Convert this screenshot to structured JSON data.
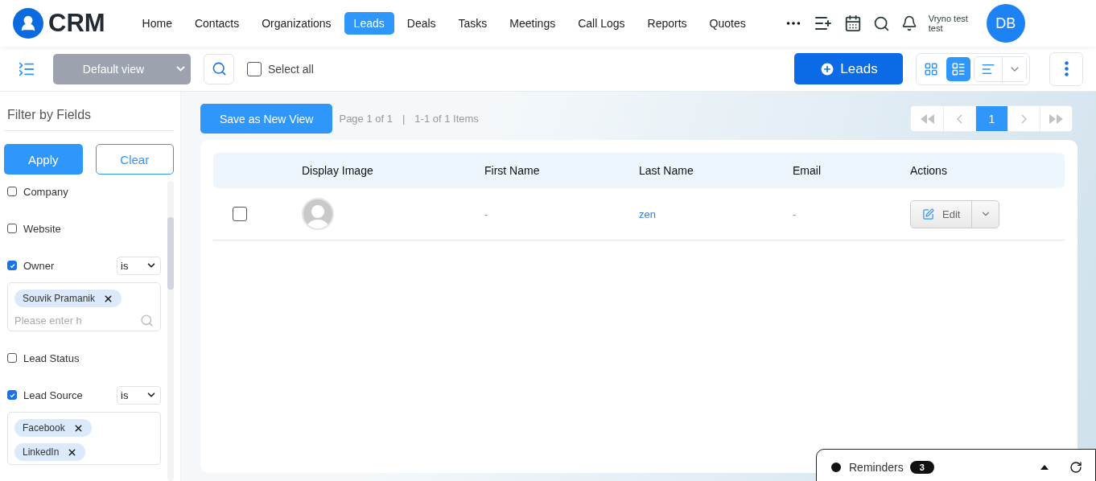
{
  "app": {
    "logo_text": "CRM"
  },
  "nav": [
    {
      "label": "Home",
      "selected": false
    },
    {
      "label": "Contacts",
      "selected": false
    },
    {
      "label": "Organizations",
      "selected": false
    },
    {
      "label": "Leads",
      "selected": true
    },
    {
      "label": "Deals",
      "selected": false
    },
    {
      "label": "Tasks",
      "selected": false
    },
    {
      "label": "Meetings",
      "selected": false
    },
    {
      "label": "Call Logs",
      "selected": false
    },
    {
      "label": "Reports",
      "selected": false
    },
    {
      "label": "Quotes",
      "selected": false
    }
  ],
  "user": {
    "name": "Vryno test test",
    "initials": "DB"
  },
  "toolbar": {
    "view": "Default view",
    "select_all": {
      "label": "Select all",
      "checked": false
    },
    "add_button": "Leads",
    "view_modes": [
      {
        "kind": "grid",
        "selected": false
      },
      {
        "kind": "list",
        "selected": true
      },
      {
        "kind": "lines",
        "selected": false
      }
    ]
  },
  "filter": {
    "title": "Filter by Fields",
    "apply": "Apply",
    "clear": "Clear",
    "fields": [
      {
        "label": "Company",
        "checked": false
      },
      {
        "label": "Website",
        "checked": false
      },
      {
        "label": "Owner",
        "checked": true,
        "operator": "is",
        "tags": [
          "Souvik Pramanik"
        ],
        "placeholder": "Please enter h"
      },
      {
        "label": "Lead Status",
        "checked": false
      },
      {
        "label": "Lead Source",
        "checked": true,
        "operator": "is",
        "tags": [
          "Facebook",
          "LinkedIn"
        ]
      }
    ]
  },
  "content": {
    "save_view": "Save as New View",
    "page_info": "Page 1 of 1",
    "separator": "|",
    "items_info": "1-1 of 1 Items",
    "pagination": [
      {
        "kind": "first",
        "selected": false
      },
      {
        "kind": "prev",
        "selected": false
      },
      {
        "kind": "page",
        "label": "1",
        "selected": true
      },
      {
        "kind": "next",
        "selected": false
      },
      {
        "kind": "last",
        "selected": false
      }
    ]
  },
  "table": {
    "columns": [
      "Display Image",
      "First Name",
      "Last Name",
      "Email",
      "Actions"
    ],
    "rows": [
      {
        "checked": false,
        "first_name": "-",
        "last_name": "zen",
        "email": "-",
        "action": "Edit"
      }
    ]
  },
  "reminders": {
    "label": "Reminders",
    "count": "3"
  }
}
